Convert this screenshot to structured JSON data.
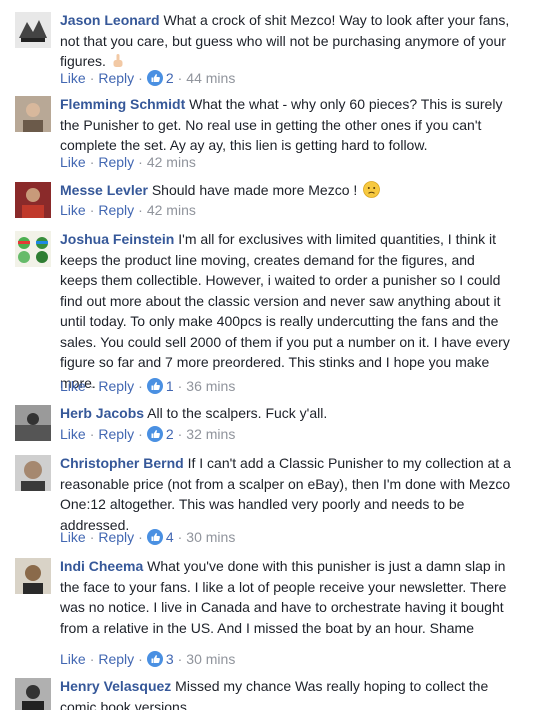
{
  "actions": {
    "like": "Like",
    "reply": "Reply",
    "separator": "·"
  },
  "colors": {
    "name": "#365899",
    "link": "#4267b2",
    "meta": "#90949c",
    "text": "#1d2129"
  },
  "comments": [
    {
      "author": "Jason Leonard",
      "text": "What a crock of shit Mezco! Way to look after your fans, not that you care, but guess who will not be purchasing anymore of your figures.",
      "inline_icon": "middle-finger-emoji-icon",
      "likes": "2",
      "time": "44 mins"
    },
    {
      "author": "Flemming Schmidt",
      "text": "What the what - why only 60 pieces? This is surely the Punisher to get. No real use in getting the other ones if you can't complete the set. Ay ay ay, this lien is getting hard to follow.",
      "likes": "",
      "time": "42 mins"
    },
    {
      "author": "Messe Levler",
      "text": "Should have made more Mezco !",
      "inline_icon": "worried-face-emoji-icon",
      "likes": "",
      "time": "42 mins"
    },
    {
      "author": "Joshua Feinstein",
      "text": "I'm all for exclusives with limited quantities, I think it keeps the product line moving, creates demand for the figures, and keeps them collectible. However, i waited to order a punisher so I could find out more about the classic version and never saw anything about it until today. To only make 400pcs is really undercutting the fans and the sales. You could sell 2000 of them if you put a number on it. I have every figure so far and 7 more preordered. This stinks and I hope you make more.",
      "likes": "1",
      "time": "36 mins"
    },
    {
      "author": "Herb Jacobs",
      "text": "All to the scalpers. Fuck y'all.",
      "likes": "2",
      "time": "32 mins"
    },
    {
      "author": "Christopher Bernd",
      "text": "If I can't add a Classic Punisher to my collection at a reasonable price (not from a scalper on eBay), then I'm done with Mezco One:12 altogether. This was handled very poorly and needs to be addressed.",
      "likes": "4",
      "time": "30 mins"
    },
    {
      "author": "Indi Cheema",
      "text": "What you've done with this punisher is just a damn slap in the face to your fans. I like a lot of people receive your newsletter. There was no notice. I live in Canada and have to orchestrate having it bought from a relative in the US. And I missed the boat by an hour. Shame",
      "likes": "3",
      "time": "30 mins"
    },
    {
      "author": "Henry Velasquez",
      "text": "Missed my chance Was really hoping to collect the comic book versions",
      "likes": "",
      "time": ""
    }
  ]
}
